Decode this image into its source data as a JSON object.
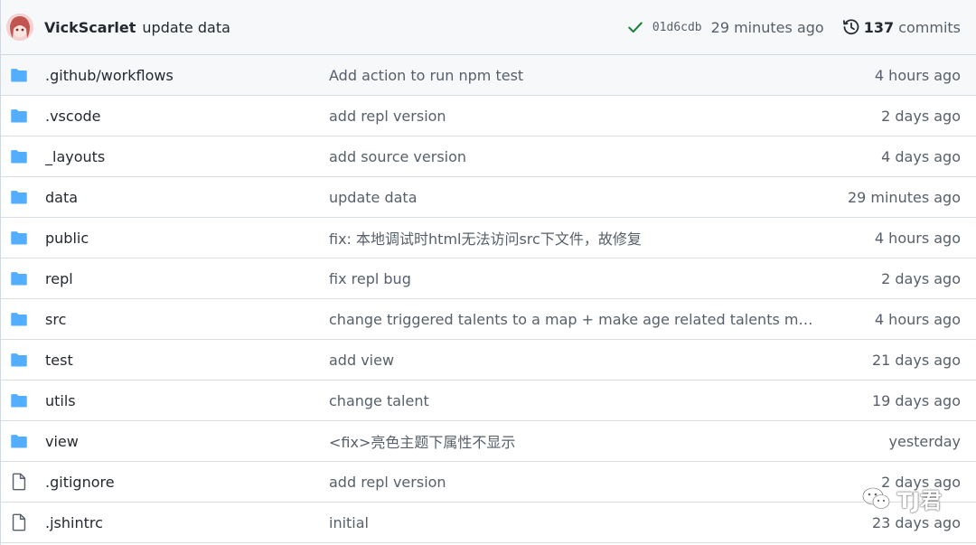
{
  "header": {
    "author": "VickScarlet",
    "message": "update data",
    "sha": "01d6cdb",
    "age": "29 minutes ago",
    "commit_count": "137",
    "commits_label": "commits",
    "icons": {
      "avatar": "avatar",
      "status": "check-icon",
      "history": "history-icon"
    },
    "colors": {
      "status_check": "#1a7f37"
    }
  },
  "files": [
    {
      "type": "folder",
      "name": ".github/workflows",
      "message": "Add action to run npm test",
      "age": "4 hours ago"
    },
    {
      "type": "folder",
      "name": ".vscode",
      "message": "add repl version",
      "age": "2 days ago"
    },
    {
      "type": "folder",
      "name": "_layouts",
      "message": "add source version",
      "age": "4 days ago"
    },
    {
      "type": "folder",
      "name": "data",
      "message": "update data",
      "age": "29 minutes ago"
    },
    {
      "type": "folder",
      "name": "public",
      "message": "fix: 本地调试时html无法访问src下文件，故修复",
      "age": "4 hours ago"
    },
    {
      "type": "folder",
      "name": "repl",
      "message": "fix repl bug",
      "age": "2 days ago"
    },
    {
      "type": "folder",
      "name": "src",
      "message": "change triggered talents to a map + make age related talents multi-tr...",
      "age": "4 hours ago"
    },
    {
      "type": "folder",
      "name": "test",
      "message": "add view",
      "age": "21 days ago"
    },
    {
      "type": "folder",
      "name": "utils",
      "message": "change talent",
      "age": "19 days ago"
    },
    {
      "type": "folder",
      "name": "view",
      "message": "<fix>亮色主题下属性不显示",
      "age": "yesterday"
    },
    {
      "type": "file",
      "name": ".gitignore",
      "message": "add repl version",
      "age": "2 days ago"
    },
    {
      "type": "file",
      "name": ".jshintrc",
      "message": "initial",
      "age": "23 days ago"
    }
  ],
  "watermark": {
    "text": "TJ君",
    "icon": "wechat-icon"
  },
  "colors": {
    "folder": "#54aeff",
    "file": "#57606a",
    "header_bg": "#f6f8fa",
    "border": "#d0d7de"
  }
}
